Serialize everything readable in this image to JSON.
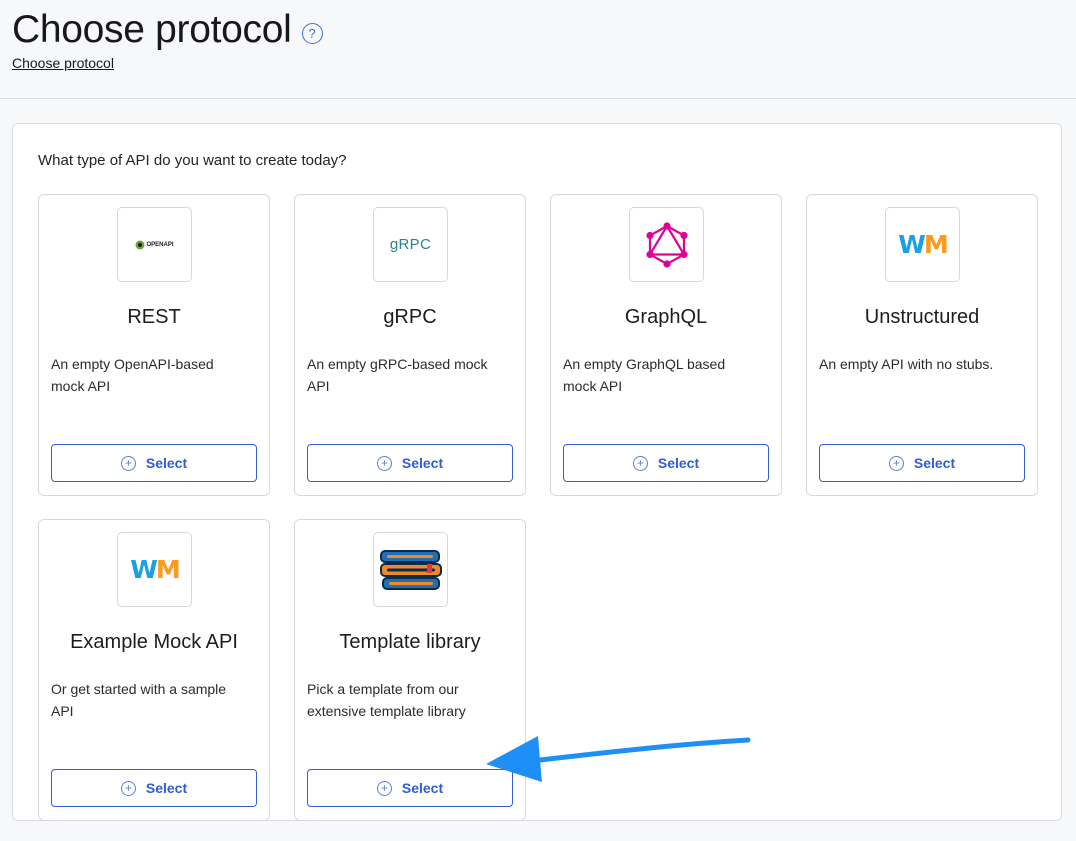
{
  "header": {
    "title": "Choose protocol",
    "breadcrumb": "Choose protocol",
    "help_icon_glyph": "?"
  },
  "main": {
    "question": "What type of API do you want to create today?",
    "cards": [
      {
        "title": "REST",
        "description": "An empty OpenAPI-based mock API",
        "logo": "openapi-logo",
        "logo_text": "OPENAPI",
        "button": "Select"
      },
      {
        "title": "gRPC",
        "description": "An empty gRPC-based mock API",
        "logo": "grpc-logo",
        "logo_text": "gRPC",
        "button": "Select"
      },
      {
        "title": "GraphQL",
        "description": "An empty GraphQL based mock API",
        "logo": "graphql-logo",
        "button": "Select"
      },
      {
        "title": "Unstructured",
        "description": "An empty API with no stubs.",
        "logo": "wiremock-logo",
        "logo_text_w": "W",
        "logo_text_m": "M",
        "button": "Select"
      },
      {
        "title": "Example Mock API",
        "description": "Or get started with a sample API",
        "logo": "wiremock-logo",
        "logo_text_w": "W",
        "logo_text_m": "M",
        "button": "Select"
      },
      {
        "title": "Template library",
        "description": "Pick a template from our extensive template library",
        "logo": "books-logo",
        "button": "Select"
      }
    ]
  },
  "colors": {
    "accent": "#2f5fd0",
    "graphql": "#e10098",
    "wm_blue": "#1ba0e4",
    "wm_orange": "#ff9b1a",
    "arrow": "#1e8ff7"
  },
  "icons": {
    "plus": "+"
  }
}
